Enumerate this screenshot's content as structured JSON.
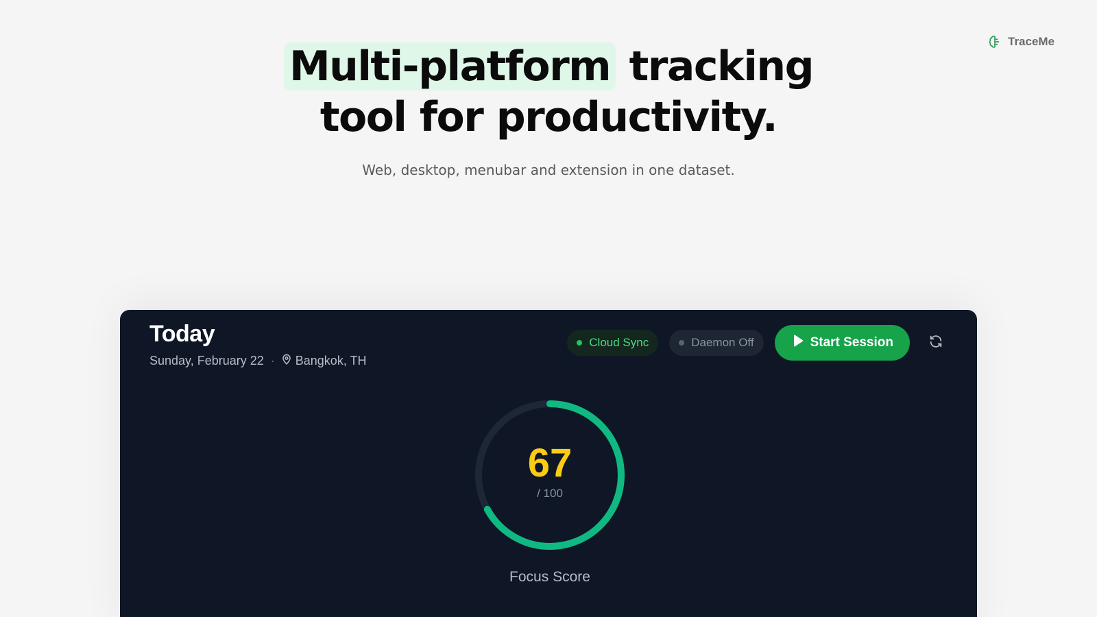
{
  "brand": {
    "name": "TraceMe",
    "icon": "brain-icon"
  },
  "hero": {
    "title_highlight": "Multi-platform",
    "title_rest_line1": " tracking",
    "title_line2": "tool for productivity.",
    "subtitle": "Web, desktop, menubar and extension in one dataset."
  },
  "dashboard": {
    "title": "Today",
    "date": "Sunday, February 22",
    "separator": "·",
    "location": "Bangkok, TH",
    "status": {
      "cloud_sync": "Cloud Sync",
      "daemon": "Daemon Off"
    },
    "start_button": "Start Session",
    "focus": {
      "score": "67",
      "score_value": 67,
      "max_label": "/ 100",
      "max_value": 100,
      "label": "Focus Score"
    }
  },
  "colors": {
    "accent": "#16a34a",
    "gauge": "#10b981",
    "score": "#facc15",
    "card_bg": "#0f1726",
    "highlight": "#dff7e8"
  }
}
